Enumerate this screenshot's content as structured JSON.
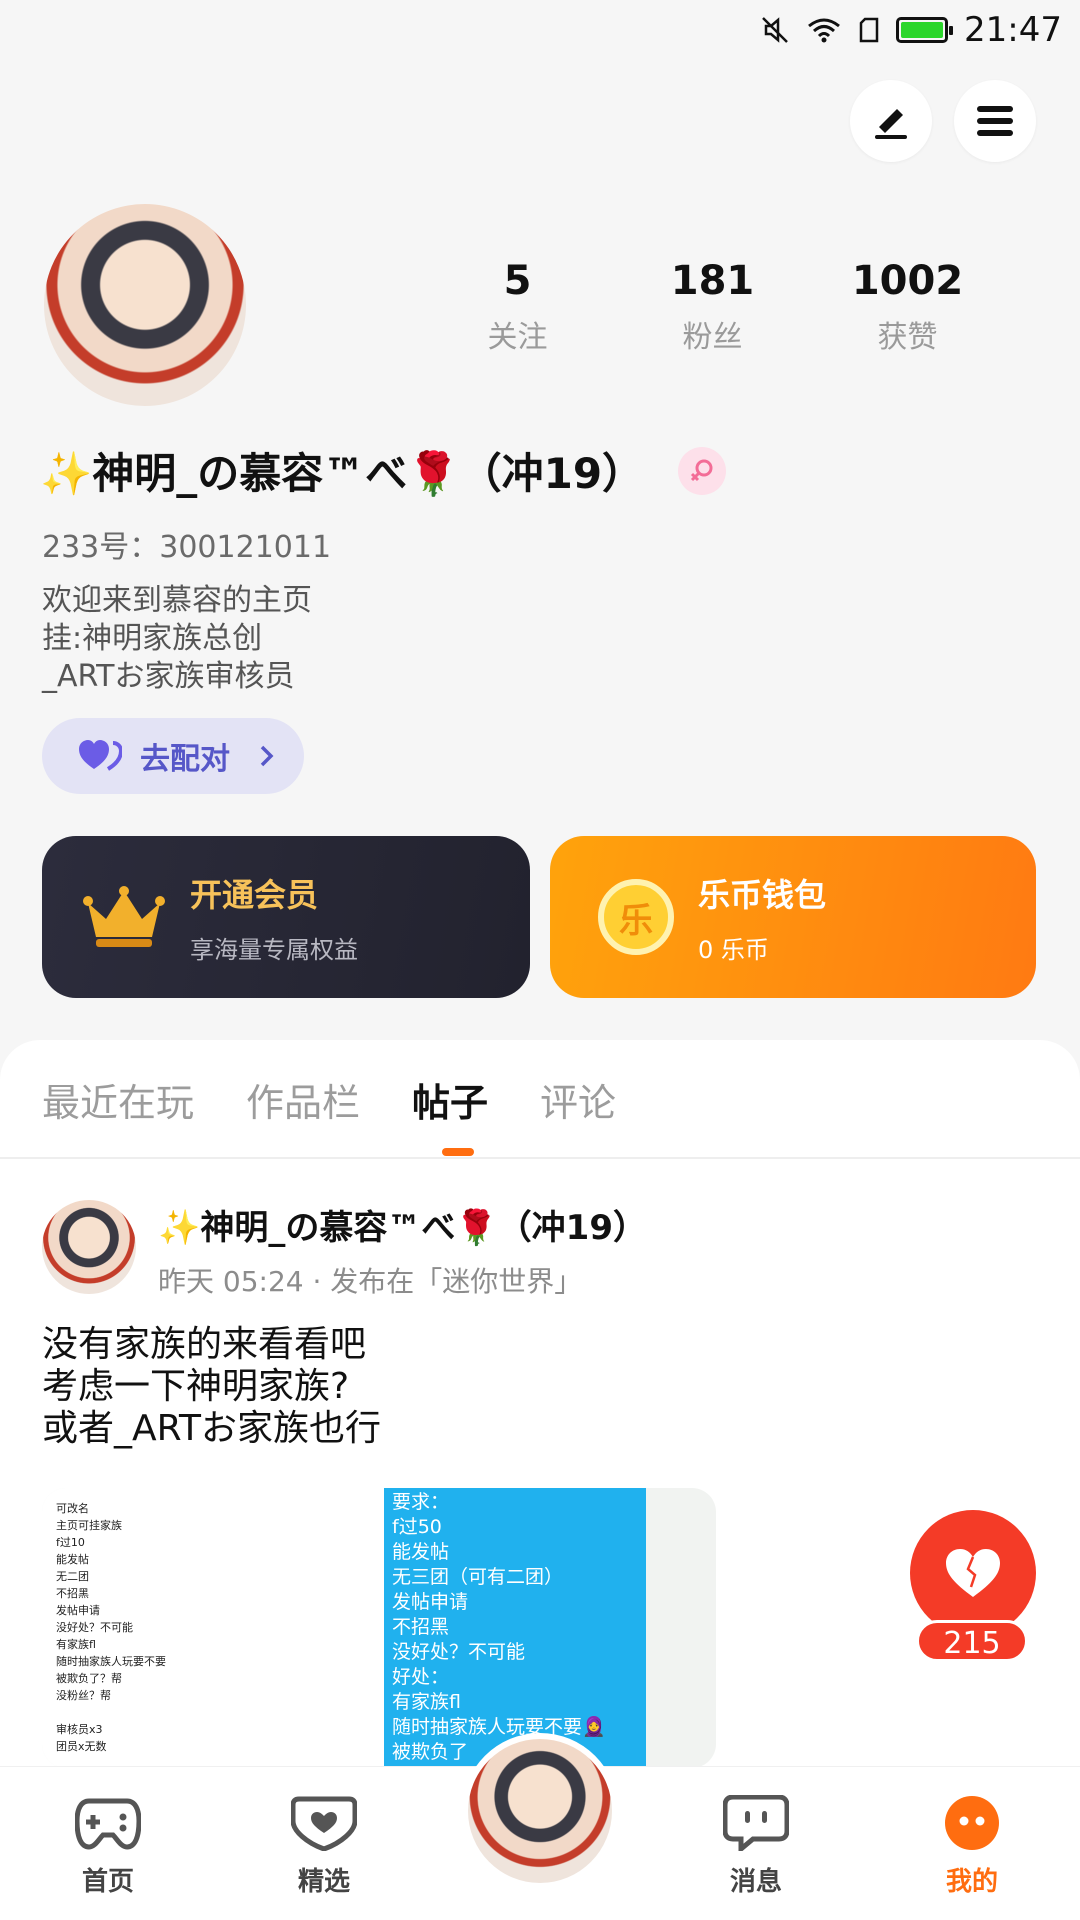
{
  "status_bar": {
    "time": "21:47",
    "icons": [
      "mute-icon",
      "wifi-icon",
      "sim-icon",
      "battery-icon"
    ]
  },
  "header": {
    "edit_icon": "edit-icon",
    "menu_icon": "menu-icon"
  },
  "profile": {
    "stats": [
      {
        "value": "5",
        "label": "关注"
      },
      {
        "value": "181",
        "label": "粉丝"
      },
      {
        "value": "1002",
        "label": "获赞"
      }
    ],
    "nickname": "✨神明_の慕容™べ🌹（冲19）",
    "uid": "233号：300121011",
    "bio": [
      "欢迎来到慕容的主页",
      "挂:神明家族总创",
      "_ARTお家族审核员"
    ],
    "match_button": "去配对"
  },
  "cards": {
    "vip": {
      "title": "开通会员",
      "subtitle": "享海量专属权益"
    },
    "wallet": {
      "title": "乐币钱包",
      "subtitle": "0 乐币",
      "coin_glyph": "乐"
    }
  },
  "tabs": [
    "最近在玩",
    "作品栏",
    "帖子",
    "评论"
  ],
  "active_tab": "帖子",
  "post": {
    "author": "✨神明_の慕容™べ🌹（冲19）",
    "meta": "昨天 05:24 · 发布在「迷你世界」",
    "text": [
      "没有家族的来看看吧",
      "考虑一下神明家族?",
      "或者_ARTお家族也行"
    ],
    "image_left_lines": [
      "可改名",
      "主页可挂家族",
      "f过10",
      "能发帖",
      "无二团",
      "不招黑",
      "发帖申请",
      "没好处？不可能",
      "有家族fl",
      "随时抽家族人玩要不要",
      "被欺负了？帮",
      "没粉丝？帮",
      "",
      "审核员x3",
      "团员x无数"
    ],
    "image_mid_lines": [
      "要求：",
      "f过50",
      "能发帖",
      "无三团（可有二团）",
      "发帖申请",
      "不招黑",
      "没好处？不可能",
      "好处：",
      "有家族fl",
      "随时抽家族人玩要不要🧕",
      "被欺负了"
    ],
    "like_count": "215"
  },
  "bottom_nav": [
    {
      "label": "首页",
      "icon": "gamepad-icon"
    },
    {
      "label": "精选",
      "icon": "heart-icon"
    },
    {
      "label": "消息",
      "icon": "chat-icon"
    },
    {
      "label": "我的",
      "icon": "profile-icon"
    }
  ],
  "colors": {
    "accent": "#ff6d10",
    "like": "#f43b27",
    "match": "#5657c8",
    "wallet": "#ff8a10",
    "vip_bg": "#26262f"
  }
}
